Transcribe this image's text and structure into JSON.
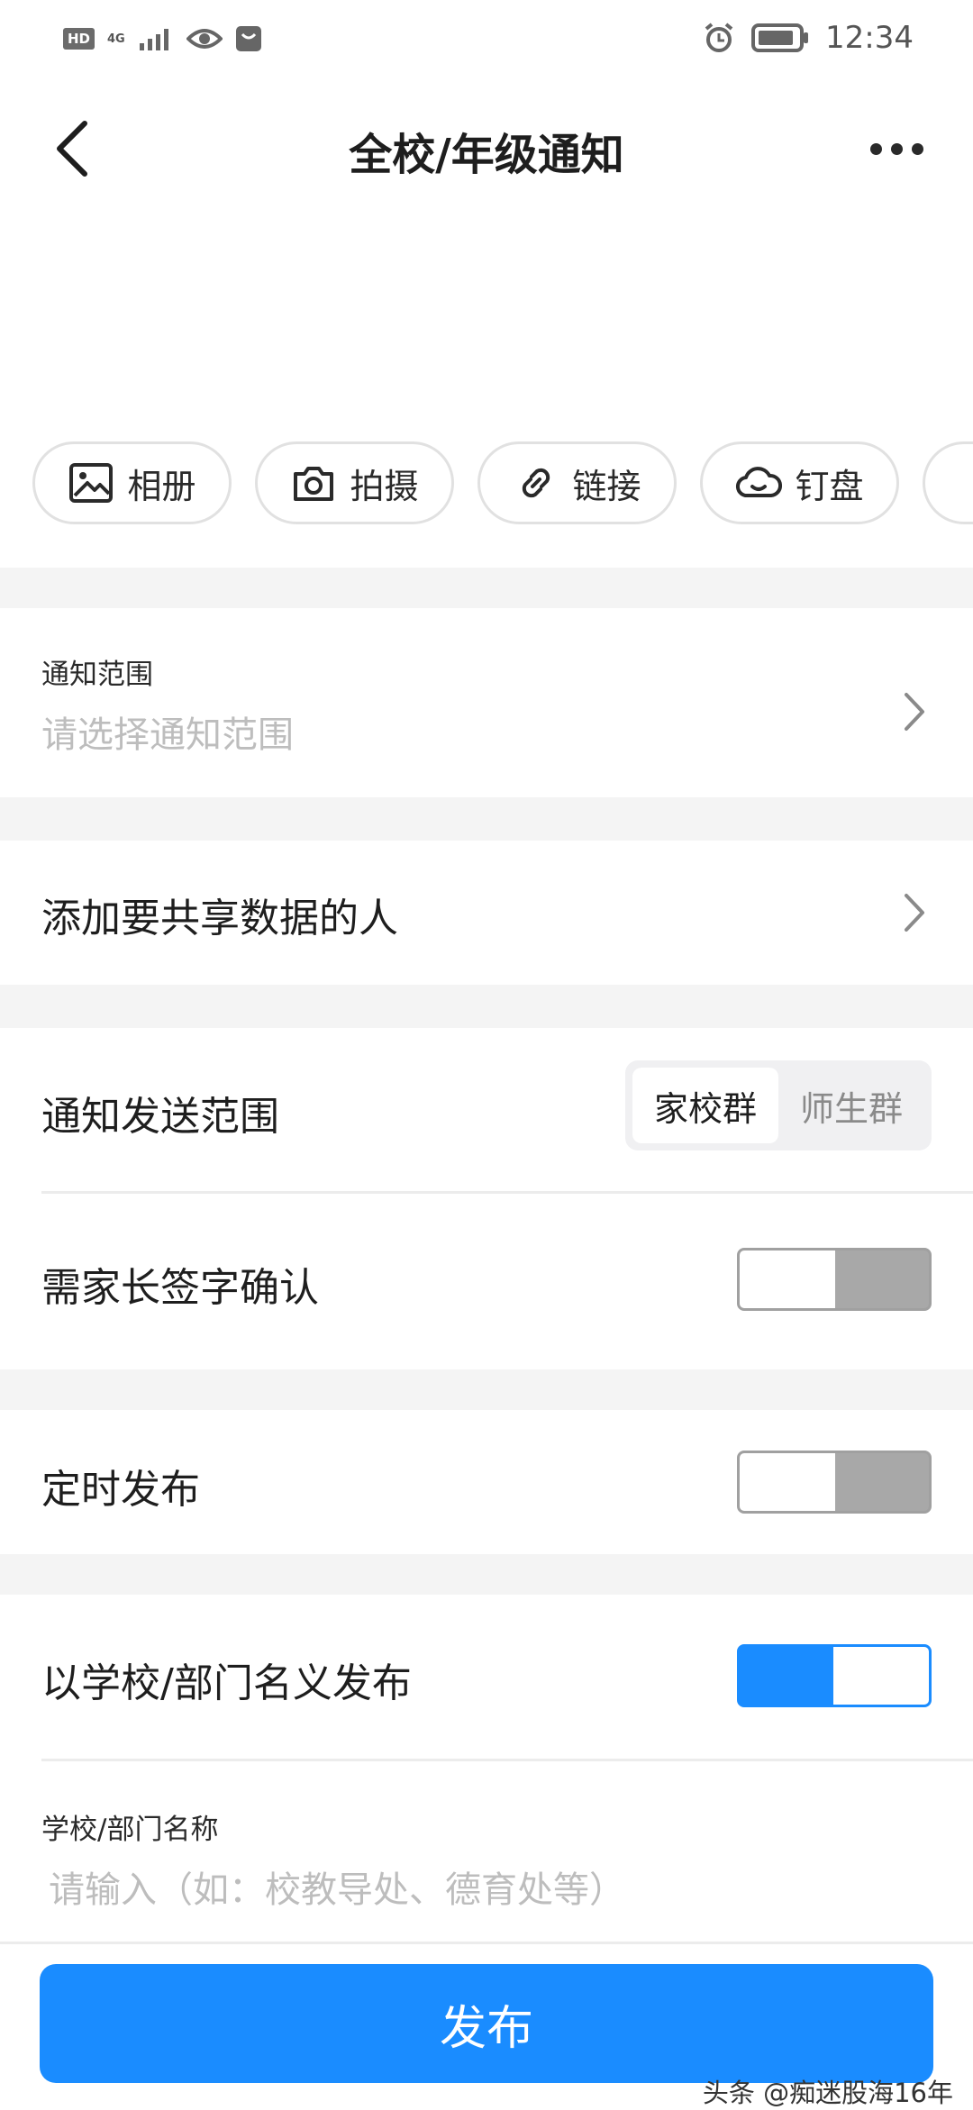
{
  "status_bar": {
    "left_badge": "HD",
    "network": "4G",
    "time": "12:34",
    "icons": [
      "hd-icon",
      "signal-icon",
      "eye-icon",
      "huawei-icon",
      "alarm-icon",
      "battery-icon"
    ]
  },
  "header": {
    "title": "全校/年级通知",
    "back_icon": "chevron-left-icon",
    "more_icon": "more-dots-icon"
  },
  "attachments": [
    {
      "label": "相册",
      "icon": "image-icon"
    },
    {
      "label": "拍摄",
      "icon": "camera-icon"
    },
    {
      "label": "链接",
      "icon": "link-icon"
    },
    {
      "label": "钉盘",
      "icon": "cloud-icon"
    }
  ],
  "scope": {
    "label": "通知范围",
    "placeholder": "请选择通知范围"
  },
  "share": {
    "label": "添加要共享数据的人"
  },
  "send_scope": {
    "label": "通知发送范围",
    "options": [
      "家校群",
      "师生群"
    ],
    "selected": "家校群"
  },
  "parent_sign": {
    "label": "需家长签字确认",
    "enabled": false
  },
  "scheduled": {
    "label": "定时发布",
    "enabled": false
  },
  "as_school": {
    "label": "以学校/部门名义发布",
    "enabled": true
  },
  "dept_name": {
    "label": "学校/部门名称",
    "placeholder": "请输入（如：校教导处、德育处等）"
  },
  "publish_label": "发布",
  "watermark": "头条 @痴迷股海16年",
  "colors": {
    "accent": "#1a8cff",
    "toggle_off": "#a8a8a8",
    "section_gap": "#f4f4f4",
    "placeholder": "#bdbdbd"
  }
}
